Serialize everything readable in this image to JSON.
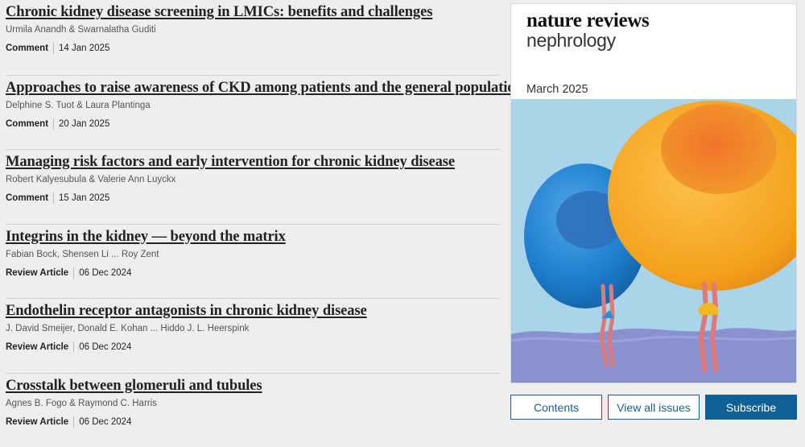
{
  "articles": [
    {
      "title": "Chronic kidney disease screening in LMICs: benefits and challenges",
      "authors": "Urmila Anandh & Swarnalatha Guditi",
      "type": "Comment",
      "date": "14 Jan 2025"
    },
    {
      "title": "Approaches to raise awareness of CKD among patients and the general population",
      "authors": "Delphine S. Tuot & Laura Plantinga",
      "type": "Comment",
      "date": "20 Jan 2025"
    },
    {
      "title": "Managing risk factors and early intervention for chronic kidney disease",
      "authors": "Robert Kalyesubula & Valerie Ann Luyckx",
      "type": "Comment",
      "date": "15 Jan 2025"
    },
    {
      "title": "Integrins in the kidney — beyond the matrix",
      "authors": "Fabian Bock, Shensen Li ... Roy Zent",
      "type": "Review Article",
      "date": "06 Dec 2024"
    },
    {
      "title": "Endothelin receptor antagonists in chronic kidney disease",
      "authors": "J. David Smeijer, Donald E. Kohan ... Hiddo J. L. Heerspink",
      "type": "Review Article",
      "date": "06 Dec 2024"
    },
    {
      "title": "Crosstalk between glomeruli and tubules",
      "authors": "Agnes B. Fogo & Raymond C. Harris",
      "type": "Review Article",
      "date": "06 Dec 2024"
    }
  ],
  "cover": {
    "brand_line1": "nature reviews",
    "brand_line2": "nephrology",
    "issue": "March 2025"
  },
  "buttons": {
    "contents": "Contents",
    "view_all_issues": "View all issues",
    "subscribe": "Subscribe"
  },
  "colors": {
    "accent": "#0f6096",
    "cover_sky": "#a9d4ea",
    "balloon_blue": "#1f7fcf",
    "balloon_orange": "#f4a11e"
  }
}
